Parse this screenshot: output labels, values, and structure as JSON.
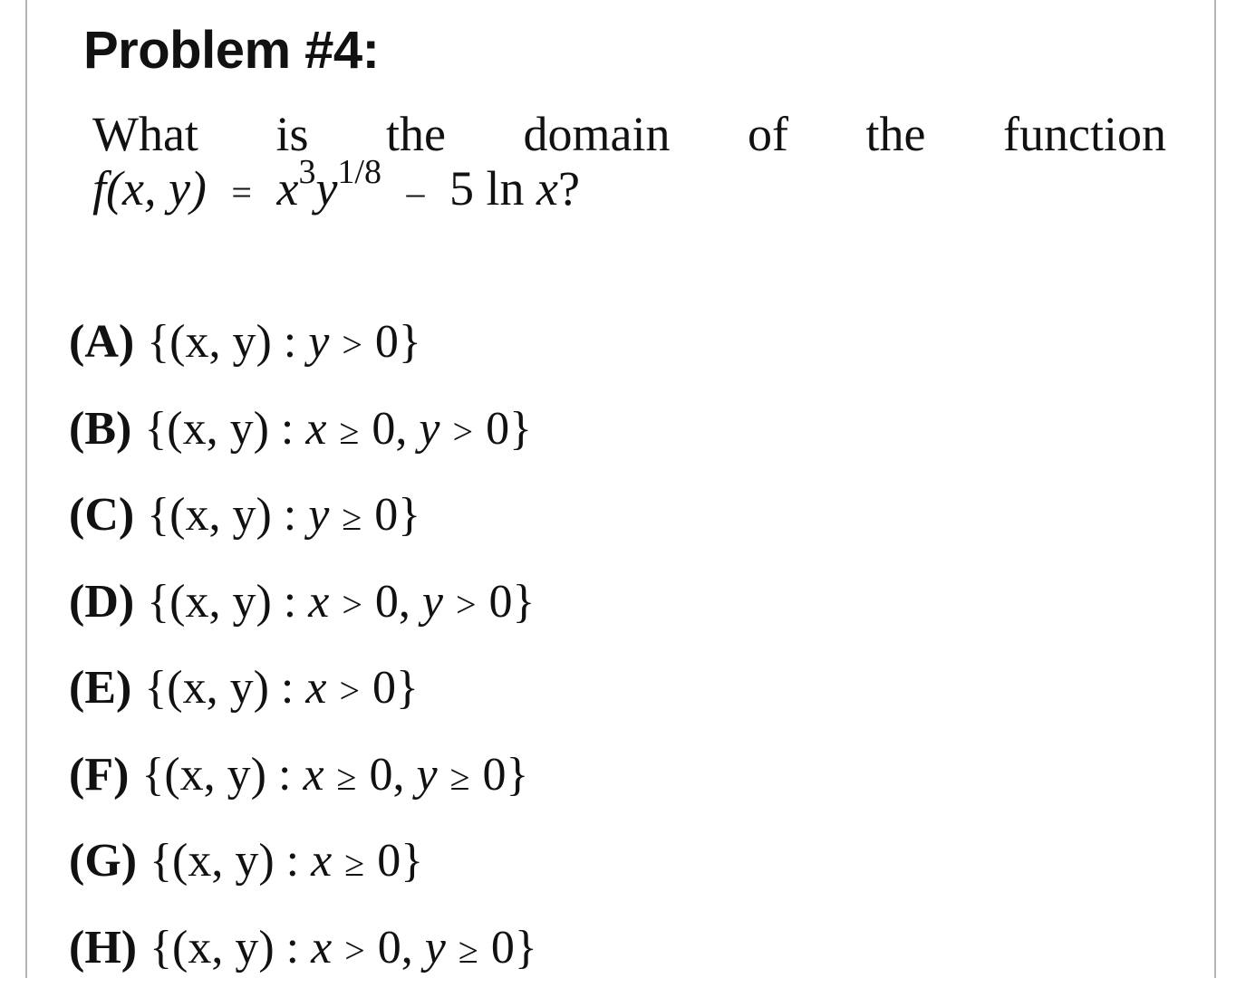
{
  "problem": {
    "title": "Problem #4:",
    "question_words": [
      "What",
      "is",
      "the",
      "domain",
      "of",
      "the",
      "function"
    ],
    "function_lhs": "f(x, y)",
    "equals": "=",
    "term1_base": "x",
    "term1_exp": "3",
    "term2_base": "y",
    "term2_exp": "1/8",
    "minus": "–",
    "term3": "5 ln",
    "term3_var": "x",
    "question_mark": "?"
  },
  "options": [
    {
      "label": "(A)",
      "set_open": "{(x, y) :",
      "conditions": [
        {
          "var": "y",
          "rel": ">",
          "val": "0"
        }
      ]
    },
    {
      "label": "(B)",
      "set_open": "{(x, y) :",
      "conditions": [
        {
          "var": "x",
          "rel": "≥",
          "val": "0"
        },
        {
          "var": "y",
          "rel": ">",
          "val": "0"
        }
      ]
    },
    {
      "label": "(C)",
      "set_open": "{(x, y) :",
      "conditions": [
        {
          "var": "y",
          "rel": "≥",
          "val": "0"
        }
      ]
    },
    {
      "label": "(D)",
      "set_open": "{(x, y) :",
      "conditions": [
        {
          "var": "x",
          "rel": ">",
          "val": "0"
        },
        {
          "var": "y",
          "rel": ">",
          "val": "0"
        }
      ]
    },
    {
      "label": "(E)",
      "set_open": "{(x, y) :",
      "conditions": [
        {
          "var": "x",
          "rel": ">",
          "val": "0"
        }
      ]
    },
    {
      "label": "(F)",
      "set_open": "{(x, y) :",
      "conditions": [
        {
          "var": "x",
          "rel": "≥",
          "val": "0"
        },
        {
          "var": "y",
          "rel": "≥",
          "val": "0"
        }
      ]
    },
    {
      "label": "(G)",
      "set_open": "{(x, y) :",
      "conditions": [
        {
          "var": "x",
          "rel": "≥",
          "val": "0"
        }
      ]
    },
    {
      "label": "(H)",
      "set_open": "{(x, y) :",
      "conditions": [
        {
          "var": "x",
          "rel": ">",
          "val": "0"
        },
        {
          "var": "y",
          "rel": "≥",
          "val": "0"
        }
      ]
    }
  ]
}
